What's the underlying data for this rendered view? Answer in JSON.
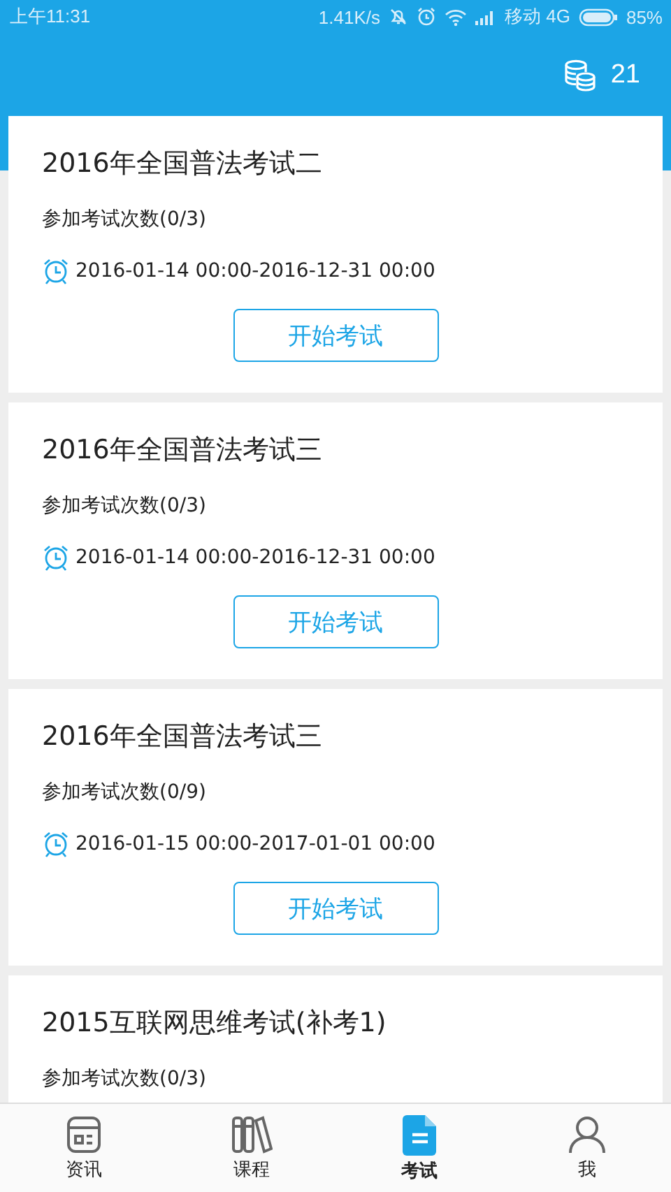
{
  "status_bar": {
    "time": "上午11:31",
    "speed": "1.41K/s",
    "carrier": "移动 4G",
    "battery": "85%"
  },
  "header": {
    "coins": "21"
  },
  "exams": [
    {
      "title": "2016年全国普法考试二",
      "attempts": "参加考试次数(0/3)",
      "period": "2016-01-14 00:00-2016-12-31 00:00",
      "button": "开始考试"
    },
    {
      "title": "2016年全国普法考试三",
      "attempts": "参加考试次数(0/3)",
      "period": "2016-01-14 00:00-2016-12-31 00:00",
      "button": "开始考试"
    },
    {
      "title": "2016年全国普法考试三",
      "attempts": "参加考试次数(0/9)",
      "period": "2016-01-15 00:00-2017-01-01 00:00",
      "button": "开始考试"
    },
    {
      "title": "2015互联网思维考试(补考1)",
      "attempts": "参加考试次数(0/3)"
    }
  ],
  "tabs": [
    {
      "kind": "news",
      "label": "资讯",
      "selected": false
    },
    {
      "kind": "courses",
      "label": "课程",
      "selected": false
    },
    {
      "kind": "exams",
      "label": "考试",
      "selected": true
    },
    {
      "kind": "me",
      "label": "我",
      "selected": false
    }
  ]
}
